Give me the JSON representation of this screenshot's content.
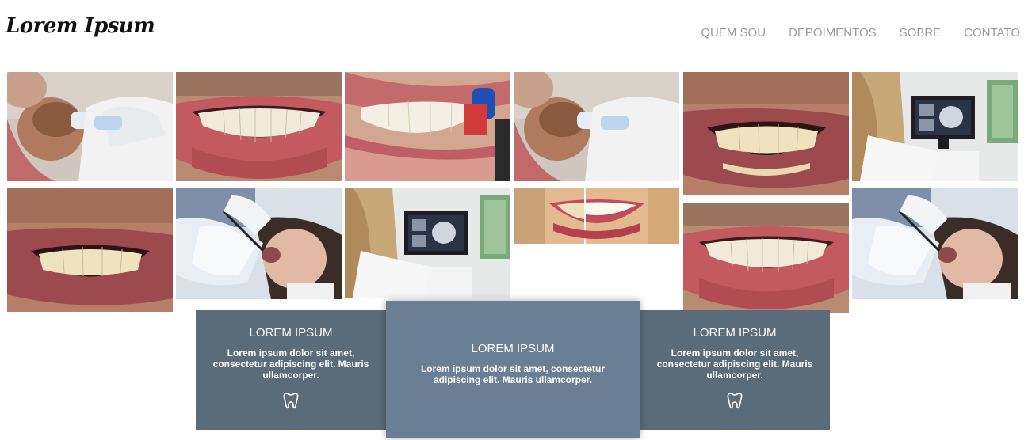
{
  "header": {
    "logo": "Lorem Ipsum",
    "nav": [
      "QUEM SOU",
      "DEPOIMENTOS",
      "SOBRE",
      "CONTATO"
    ]
  },
  "gallery": {
    "photos": [
      {
        "name": "photo-child-dental-exam",
        "icon": "photo"
      },
      {
        "name": "photo-smile-teeth",
        "icon": "photo"
      },
      {
        "name": "photo-toothbrush-lips",
        "icon": "photo"
      },
      {
        "name": "photo-child-dental-exam-2",
        "icon": "photo"
      },
      {
        "name": "photo-man-teeth",
        "icon": "photo"
      },
      {
        "name": "photo-xray-monitor",
        "icon": "photo"
      },
      {
        "name": "photo-man-teeth-2",
        "icon": "photo"
      },
      {
        "name": "photo-dentist-patient",
        "icon": "photo"
      },
      {
        "name": "photo-xray-monitor-2",
        "icon": "photo"
      },
      {
        "name": "photo-whitening-comparison",
        "icon": "photo"
      },
      {
        "name": "photo-smile-teeth-2",
        "icon": "photo"
      },
      {
        "name": "photo-dentist-patient-2",
        "icon": "photo"
      }
    ]
  },
  "cards": [
    {
      "title": "LOREM IPSUM",
      "text": "Lorem ipsum dolor sit amet, consectetur adipiscing elit. Mauris ullamcorper.",
      "icon": "tooth-icon"
    },
    {
      "title": "LOREM IPSUM",
      "text": "Lorem ipsum dolor sit amet, consectetur adipiscing elit. Mauris ullamcorper."
    },
    {
      "title": "LOREM IPSUM",
      "text": "Lorem ipsum dolor sit amet, consectetur adipiscing elit. Mauris ullamcorper.",
      "icon": "tooth-icon"
    }
  ],
  "colors": {
    "card": "#5a6b79",
    "card_center": "#6a7f93",
    "nav": "#9a9a9a"
  }
}
